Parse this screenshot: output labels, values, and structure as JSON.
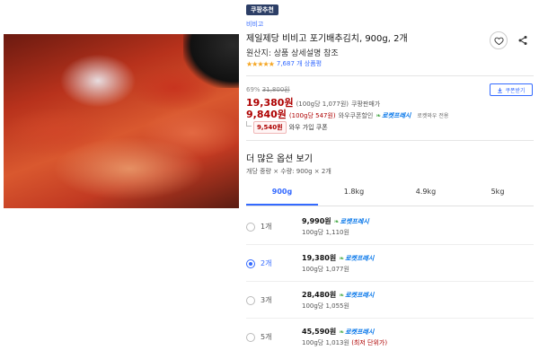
{
  "badge": "쿠팡추천",
  "brand": "비비고",
  "title": "제일제당 비비고 포기배추김치, 900g, 2개",
  "origin": "원산지: 상품 상세설명 참조",
  "rating": {
    "stars": "★★★★★",
    "value": 5,
    "count_text": "7,687 개 상품평"
  },
  "price": {
    "discount_rate": "69%",
    "original": "31,800원",
    "sale": "19,380원",
    "sale_unit": "(100g당 1,077원)",
    "sale_type": "쿠팡판매가",
    "wow": "9,840원",
    "wow_unit": "(100g당 547원)",
    "wow_type": "와우쿠폰할인",
    "rocket_fresh": "로켓프레시",
    "rocket_wow": "로켓와우 전용",
    "coupon_button": "쿠폰받기",
    "wow_coupon_amount": "9,540원",
    "wow_coupon_text": "와우 가입 쿠폰"
  },
  "options": {
    "heading": "더 많은 옵션 보기",
    "summary": "개당 중량 × 수량: 900g × 2개",
    "tabs": [
      "900g",
      "1.8kg",
      "4.9kg",
      "5kg"
    ],
    "selected_tab": 0,
    "rows": [
      {
        "qty": "1개",
        "price": "9,990원",
        "fresh": "로켓프레시",
        "unit": "100g당 1,110원",
        "lowest": "",
        "selected": false
      },
      {
        "qty": "2개",
        "price": "19,380원",
        "fresh": "로켓프레시",
        "unit": "100g당 1,077원",
        "lowest": "",
        "selected": true
      },
      {
        "qty": "3개",
        "price": "28,480원",
        "fresh": "로켓프레시",
        "unit": "100g당 1,055원",
        "lowest": "",
        "selected": false
      },
      {
        "qty": "5개",
        "price": "45,590원",
        "fresh": "로켓프레시",
        "unit": "100g당 1,013원",
        "lowest": "(최저 단위가)",
        "selected": false
      }
    ]
  },
  "colors": {
    "accent": "#346aff",
    "price_red": "#ae0000",
    "badge_bg": "#2c3e66",
    "fresh_blue": "#0073e9",
    "star": "#f5a623"
  },
  "icons": [
    "heart-icon",
    "share-icon",
    "download-icon",
    "leaf-icon"
  ]
}
